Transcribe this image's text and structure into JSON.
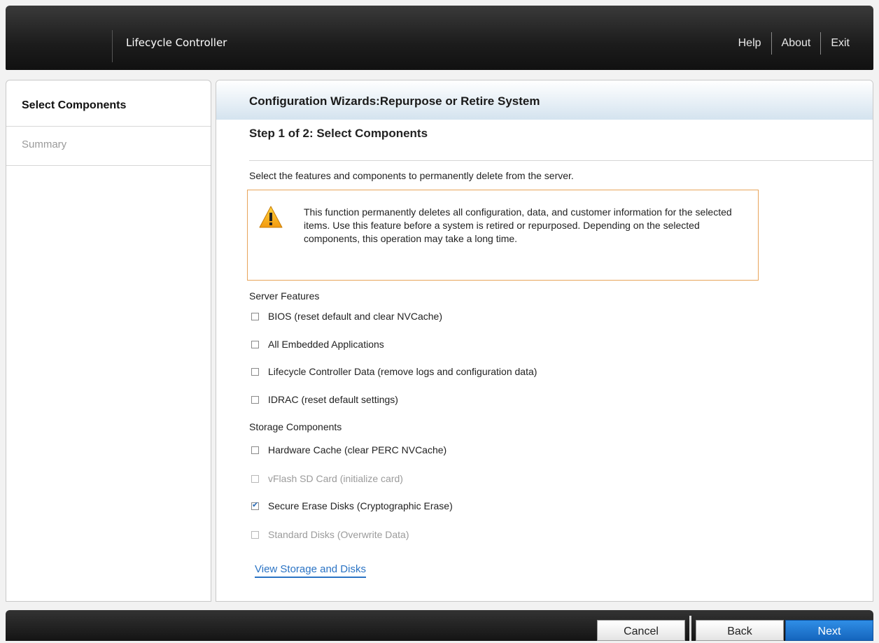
{
  "header": {
    "app_title": "Lifecycle Controller",
    "nav": {
      "help": "Help",
      "about": "About",
      "exit": "Exit"
    }
  },
  "sidebar": {
    "items": [
      {
        "label": "Select Components",
        "state": "active"
      },
      {
        "label": "Summary",
        "state": "disabled"
      }
    ]
  },
  "main": {
    "header_title": "Configuration Wizards:Repurpose or Retire System",
    "step_title": "Step 1 of 2: Select Components",
    "intro": "Select the features and components to permanently delete from the server.",
    "warning": {
      "icon": "warning-triangle-icon",
      "text": "This function permanently deletes all configuration, data, and customer information for the selected items. Use this feature before a system is retired or repurposed. Depending on the selected components, this operation may take a long time."
    },
    "server_features": {
      "label": "Server Features",
      "options": [
        {
          "label": "BIOS (reset default and clear NVCache)",
          "checked": false,
          "disabled": false
        },
        {
          "label": "All Embedded Applications",
          "checked": false,
          "disabled": false
        },
        {
          "label": "Lifecycle Controller Data (remove logs and configuration data)",
          "checked": false,
          "disabled": false
        },
        {
          "label": "IDRAC (reset default settings)",
          "checked": false,
          "disabled": false
        }
      ]
    },
    "storage_components": {
      "label": "Storage Components",
      "options": [
        {
          "label": "Hardware Cache (clear PERC NVCache)",
          "checked": false,
          "disabled": false
        },
        {
          "label": "vFlash SD Card (initialize card)",
          "checked": false,
          "disabled": true
        },
        {
          "label": "Secure Erase Disks (Cryptographic Erase)",
          "checked": true,
          "disabled": false
        },
        {
          "label": "Standard Disks (Overwrite Data)",
          "checked": false,
          "disabled": true
        }
      ]
    },
    "link": "View Storage and Disks"
  },
  "footer": {
    "cancel": "Cancel",
    "back": "Back",
    "next": "Next"
  },
  "colors": {
    "accent": "#1565bd",
    "warning_border": "#e8a45a",
    "link": "#2a73c4"
  }
}
